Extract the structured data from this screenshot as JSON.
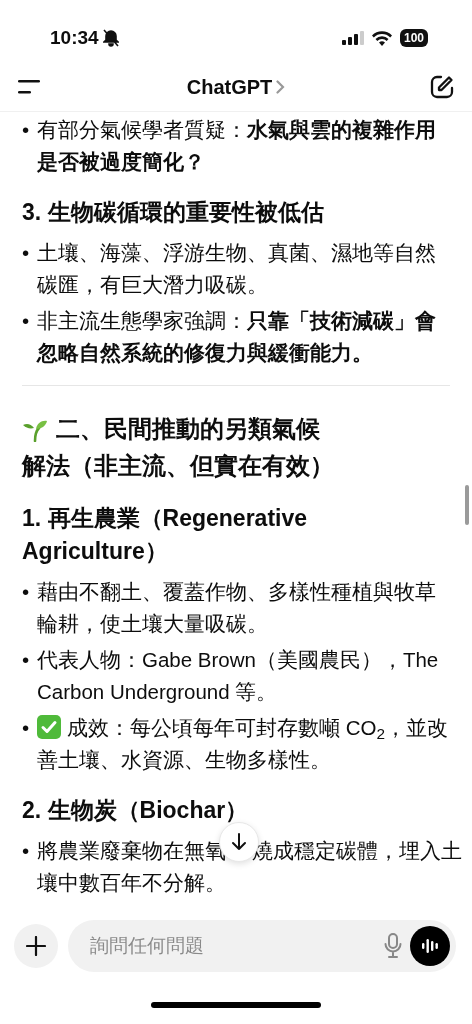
{
  "status_bar": {
    "time": "10:34",
    "battery": "100"
  },
  "header": {
    "title": "ChatGPT"
  },
  "content": [
    {
      "kind": "bullets",
      "items": [
        {
          "kind": "plain",
          "marker": "•",
          "text": "有部分氣候學者質疑：**水氣與雲的複雜作用是否被過度簡化？**"
        }
      ]
    },
    {
      "kind": "heading",
      "text": "3. 生物碳循環的重要性被低估"
    },
    {
      "kind": "bullets",
      "items": [
        {
          "kind": "plain",
          "marker": "•",
          "text": "土壤、海藻、浮游生物、真菌、濕地等自然碳匯，有巨大潛力吸碳。"
        },
        {
          "kind": "plain",
          "marker": "•",
          "text": "非主流生態學家強調：**只靠「技術減碳」會忽略自然系統的修復力與緩衝能力。**"
        }
      ]
    },
    {
      "kind": "divider"
    },
    {
      "kind": "section",
      "lines": [
        "二、民間推動的另類氣候",
        "解法（非主流、但實在有效）"
      ]
    },
    {
      "kind": "heading",
      "text": "1. 再生農業（Regenerative Agriculture）"
    },
    {
      "kind": "bullets",
      "items": [
        {
          "kind": "plain",
          "marker": "•",
          "text": "藉由不翻土、覆蓋作物、多樣性種植與牧草輪耕，使土壤大量吸碳。"
        },
        {
          "kind": "plain",
          "marker": "•",
          "text": "代表人物：Gabe Brown（美國農民），The Carbon Underground 等。"
        },
        {
          "kind": "check",
          "marker": "•",
          "lines": [
            "成效：每公頃每年可封存數噸 CO$_{2}$，並改",
            "善土壤、水資源、生物多樣性。"
          ]
        }
      ]
    },
    {
      "kind": "heading",
      "text": "2. 生物炭（Biochar）"
    },
    {
      "kind": "bullets",
      "items": [
        {
          "kind": "covered",
          "marker": "•",
          "parts": [
            "將農業廢棄物在無氧",
            "燒成穩定碳體，埋入土",
            "壤中數百年不分解。"
          ]
        }
      ]
    }
  ],
  "composer": {
    "placeholder": "詢問任何問題"
  }
}
